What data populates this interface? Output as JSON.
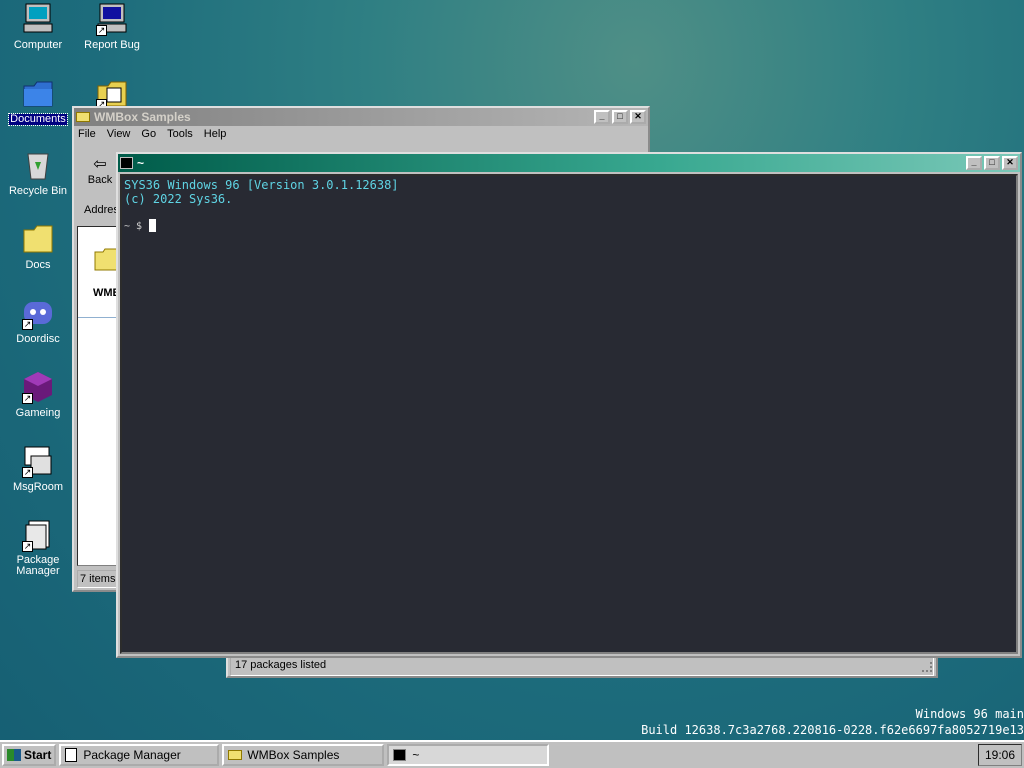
{
  "desktop": {
    "icons": [
      {
        "label": "Computer",
        "icon": "computer-icon"
      },
      {
        "label": "Report Bug",
        "icon": "report-bug-icon"
      },
      {
        "label": "Documents",
        "icon": "documents-folder-icon"
      },
      {
        "label": "Recycle Bin",
        "icon": "recycle-bin-icon"
      },
      {
        "label": "Docs",
        "icon": "folder-icon"
      },
      {
        "label": "Doordisc",
        "icon": "doordisc-icon"
      },
      {
        "label": "Gameing",
        "icon": "gameing-icon"
      },
      {
        "label": "MsgRoom",
        "icon": "msgroom-icon"
      },
      {
        "label": "Package Manager",
        "icon": "package-manager-icon"
      }
    ]
  },
  "explorer": {
    "title": "WMBox Samples",
    "menu": [
      "File",
      "View",
      "Go",
      "Tools",
      "Help"
    ],
    "back_label": "Back",
    "address_label": "Addres",
    "item_label": "WMB",
    "status": "7 items"
  },
  "package_manager": {
    "status": "17 packages listed"
  },
  "terminal": {
    "title": "~",
    "line1": "SYS36 Windows 96 [Version 3.0.1.12638]",
    "line2": "(c) 2022 Sys36.",
    "prompt": "~ $"
  },
  "taskbar": {
    "start": "Start",
    "tasks": [
      "Package Manager",
      "WMBox Samples",
      "~"
    ],
    "clock": "19:06"
  },
  "watermark": {
    "line1": "Windows 96 main",
    "line2": "Build 12638.7c3a2768.220816-0228.f62e6697fa8052719e13"
  },
  "colors": {
    "terminal_bg": "#282a33",
    "terminal_text": "#5fd4e4",
    "active_title": "#38a890"
  }
}
